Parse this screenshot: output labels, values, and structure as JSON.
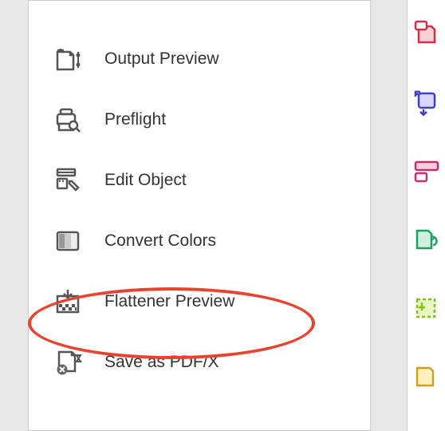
{
  "menu": {
    "items": [
      {
        "label": "Output Preview"
      },
      {
        "label": "Preflight"
      },
      {
        "label": "Edit Object"
      },
      {
        "label": "Convert Colors"
      },
      {
        "label": "Flattener Preview"
      },
      {
        "label": "Save as PDF/X"
      }
    ]
  }
}
